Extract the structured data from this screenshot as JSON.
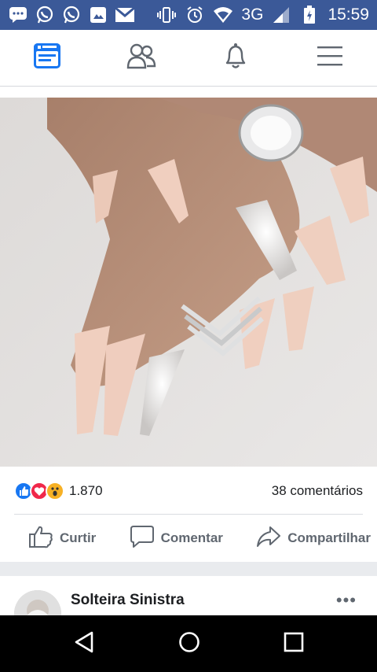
{
  "status_bar": {
    "network": "3G",
    "time": "15:59",
    "left_icons": [
      "message-icon",
      "whatsapp-icon",
      "whatsapp-business-icon",
      "gallery-icon",
      "gmail-icon"
    ],
    "right_icons": [
      "vibrate-icon",
      "alarm-icon",
      "wifi-icon",
      "signal-icon",
      "battery-charging-icon"
    ]
  },
  "navbar": {
    "items": [
      {
        "name": "news-feed",
        "icon": "news-feed-icon",
        "active": true
      },
      {
        "name": "friends",
        "icon": "friends-icon",
        "active": false
      },
      {
        "name": "notifications",
        "icon": "bell-icon",
        "active": false
      },
      {
        "name": "menu",
        "icon": "hamburger-menu-icon",
        "active": false
      }
    ]
  },
  "post": {
    "image_description": "",
    "watermark_text": "",
    "reactions_count": "1.870",
    "comments": "38 comentários",
    "actions": {
      "like": "Curtir",
      "comment": "Comentar",
      "share": "Compartilhar"
    }
  },
  "next_post": {
    "author": "Solteira Sinistra",
    "more": "•••"
  },
  "colors": {
    "brand": "#3b5998",
    "like_blue": "#1877f2",
    "love_red": "#f0284a",
    "wow_yellow": "#f7b125"
  }
}
